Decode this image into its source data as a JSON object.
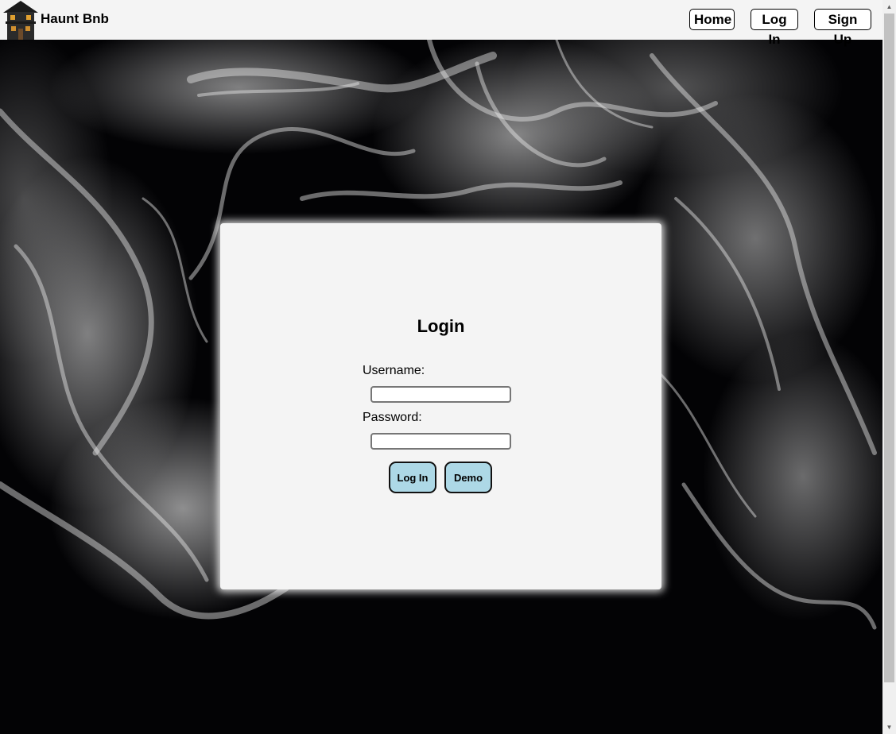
{
  "navbar": {
    "brand": "Haunt Bnb",
    "logo_icon": "haunted-house-icon",
    "home_label": "Home",
    "login_label": "Log In",
    "signup_label": "Sign Up"
  },
  "login_form": {
    "title": "Login",
    "username_label": "Username:",
    "username_value": "",
    "password_label": "Password:",
    "password_value": "",
    "login_button": "Log In",
    "demo_button": "Demo"
  },
  "colors": {
    "navbar_bg": "#f4f4f4",
    "card_bg": "#f4f4f4",
    "button_bg": "#add8e6",
    "page_bg": "#000000"
  }
}
